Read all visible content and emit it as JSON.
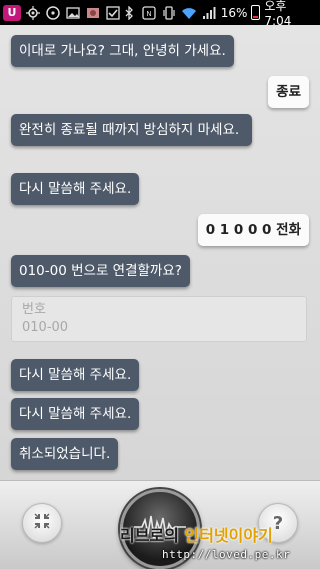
{
  "status_bar": {
    "carrier_badge": "U",
    "battery_percent": "16%",
    "time": "오후 7:04",
    "icons": [
      "carrier-icon",
      "gps-icon",
      "steering-icon",
      "gallery-icon",
      "photo-icon",
      "check-icon",
      "bluetooth-icon",
      "nfc-icon",
      "vibrate-icon",
      "wifi-icon",
      "signal-icon",
      "battery-icon"
    ]
  },
  "messages": [
    {
      "role": "sys",
      "text": "이대로 가나요? 그대, 안녕히 가세요."
    },
    {
      "role": "user",
      "text": "종료"
    },
    {
      "role": "sys",
      "text": "완전히 종료될 때까지 방심하지 마세요."
    },
    {
      "role": "sys",
      "text": "다시 말씀해 주세요."
    },
    {
      "role": "user",
      "text": "0 1 0 0 0 전화"
    },
    {
      "role": "sys",
      "text": "010-00 번으로 연결할까요?"
    },
    {
      "role": "sys",
      "text": "다시 말씀해 주세요."
    },
    {
      "role": "sys",
      "text": "다시 말씀해 주세요."
    },
    {
      "role": "sys",
      "text": "취소되었습니다."
    }
  ],
  "contact_card": {
    "label": "번호",
    "value": "010-00"
  },
  "bottom_bar": {
    "help_symbol": "?",
    "minimize_icon": "minimize-icon",
    "mic_icon": "waveform-mic-icon"
  },
  "watermark": {
    "title_a": "리브로",
    "title_b": "의 ",
    "title_c": "인터넷이야기",
    "url": "http://loved.pe.kr"
  },
  "colors": {
    "system_bubble": "#4e5a6a",
    "user_bubble": "#fbfbfb",
    "background": "#dcdcdc"
  }
}
